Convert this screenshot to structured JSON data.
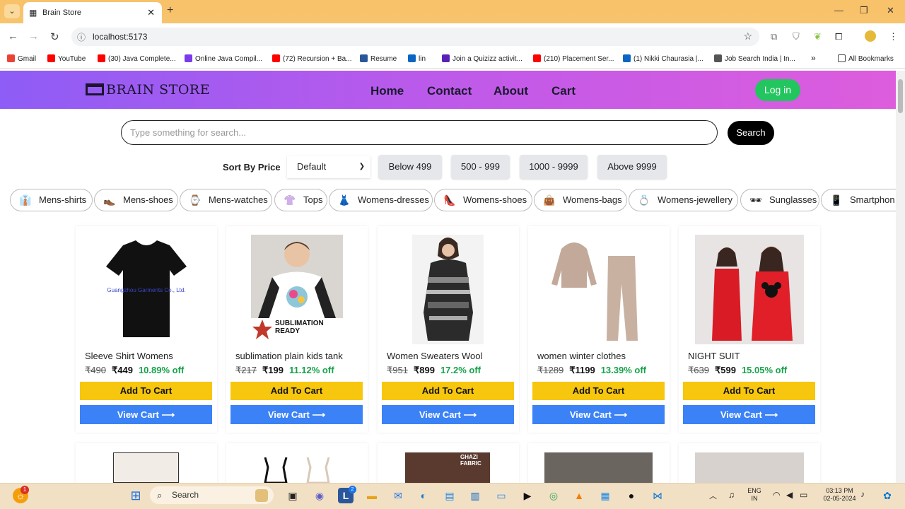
{
  "browser": {
    "tab_title": "Brain Store",
    "url": "localhost:5173",
    "bookmarks": [
      {
        "label": "Gmail",
        "color": "#ea4335"
      },
      {
        "label": "YouTube",
        "color": "#ff0000"
      },
      {
        "label": "(30) Java Complete...",
        "color": "#ff0000"
      },
      {
        "label": "Online Java Compil...",
        "color": "#7c3aed"
      },
      {
        "label": "(72) Recursion + Ba...",
        "color": "#ff0000"
      },
      {
        "label": "Resume",
        "color": "#2b579a"
      },
      {
        "label": "lin",
        "color": "#0a66c2"
      },
      {
        "label": "Join a Quizizz activit...",
        "color": "#5b21b6"
      },
      {
        "label": "(210) Placement Ser...",
        "color": "#ff0000"
      },
      {
        "label": "(1) Nikki Chaurasia |...",
        "color": "#0a66c2"
      },
      {
        "label": "Job Search India | In...",
        "color": "#555555"
      }
    ],
    "all_bookmarks": "All Bookmarks",
    "more": "»"
  },
  "site": {
    "brand": "BRAIN STORE",
    "nav": [
      "Home",
      "Contact",
      "About",
      "Cart"
    ],
    "login": "Log in",
    "search_placeholder": "Type something for search...",
    "search_button": "Search",
    "sort_label": "Sort By Price",
    "sort_value": "Default",
    "price_filters": [
      "Below 499",
      "500 - 999",
      "1000 - 9999",
      "Above 9999"
    ],
    "categories": [
      {
        "label": "Mens-shirts",
        "icon": "shirt-icon",
        "glyph": "👔"
      },
      {
        "label": "Mens-shoes",
        "icon": "shoe-icon",
        "glyph": "👞"
      },
      {
        "label": "Mens-watches",
        "icon": "watch-icon",
        "glyph": "⌚"
      },
      {
        "label": "Tops",
        "icon": "top-icon",
        "glyph": "👚"
      },
      {
        "label": "Womens-dresses",
        "icon": "dress-icon",
        "glyph": "👗"
      },
      {
        "label": "Womens-shoes",
        "icon": "heel-icon",
        "glyph": "👠"
      },
      {
        "label": "Womens-bags",
        "icon": "bag-icon",
        "glyph": "👜"
      },
      {
        "label": "Womens-jewellery",
        "icon": "jewel-icon",
        "glyph": "💍"
      },
      {
        "label": "Sunglasses",
        "icon": "sunglasses-icon",
        "glyph": "🕶"
      },
      {
        "label": "Smartphon",
        "icon": "phone-icon",
        "glyph": "📱"
      }
    ],
    "products": [
      {
        "name": "Sleeve Shirt Womens",
        "old": "₹490",
        "price": "₹449",
        "off": "10.89% off",
        "img_text": "Guangzhou Garments Co., Ltd."
      },
      {
        "name": "sublimation plain kids tank",
        "old": "₹217",
        "price": "₹199",
        "off": "11.12% off",
        "img_text": "SUBLIMATION READY"
      },
      {
        "name": "Women Sweaters Wool",
        "old": "₹951",
        "price": "₹899",
        "off": "17.2% off",
        "img_text": ""
      },
      {
        "name": "women winter clothes",
        "old": "₹1289",
        "price": "₹1199",
        "off": "13.39% off",
        "img_text": ""
      },
      {
        "name": "NIGHT SUIT",
        "old": "₹639",
        "price": "₹599",
        "off": "15.05% off",
        "img_text": ""
      }
    ],
    "add_to_cart": "Add To Cart",
    "view_cart": "View Cart  ⟶",
    "second_row_badge": "GHAZI FABRIC"
  },
  "taskbar": {
    "search": "Search",
    "lang": "ENG",
    "region": "IN",
    "time": "03:13 PM",
    "date": "02-05-2024",
    "notif_badge": "1",
    "l_badge": "2"
  }
}
